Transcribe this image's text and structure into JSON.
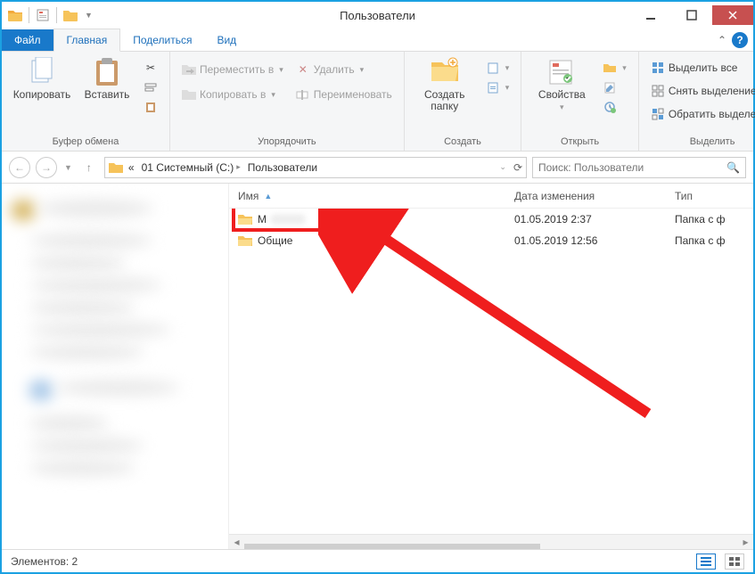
{
  "window": {
    "title": "Пользователи"
  },
  "tabs": {
    "file": "Файл",
    "home": "Главная",
    "share": "Поделиться",
    "view": "Вид"
  },
  "ribbon": {
    "clipboard": {
      "copy": "Копировать",
      "paste": "Вставить",
      "label": "Буфер обмена"
    },
    "organize": {
      "move_to": "Переместить в",
      "copy_to": "Копировать в",
      "delete": "Удалить",
      "rename": "Переименовать",
      "label": "Упорядочить"
    },
    "new": {
      "new_folder_l1": "Создать",
      "new_folder_l2": "папку",
      "label": "Создать"
    },
    "open": {
      "properties": "Свойства",
      "label": "Открыть"
    },
    "select": {
      "select_all": "Выделить все",
      "select_none": "Снять выделение",
      "invert": "Обратить выделение",
      "label": "Выделить"
    }
  },
  "breadcrumb": {
    "item1": "01 Системный (C:)",
    "item2": "Пользователи"
  },
  "search": {
    "placeholder": "Поиск: Пользователи"
  },
  "columns": {
    "name": "Имя",
    "date": "Дата изменения",
    "type": "Тип"
  },
  "rows": [
    {
      "name": "M",
      "date": "01.05.2019 2:37",
      "type": "Папка с ф"
    },
    {
      "name": "Общие",
      "date": "01.05.2019 12:56",
      "type": "Папка с ф"
    }
  ],
  "status": {
    "items": "Элементов: 2"
  }
}
